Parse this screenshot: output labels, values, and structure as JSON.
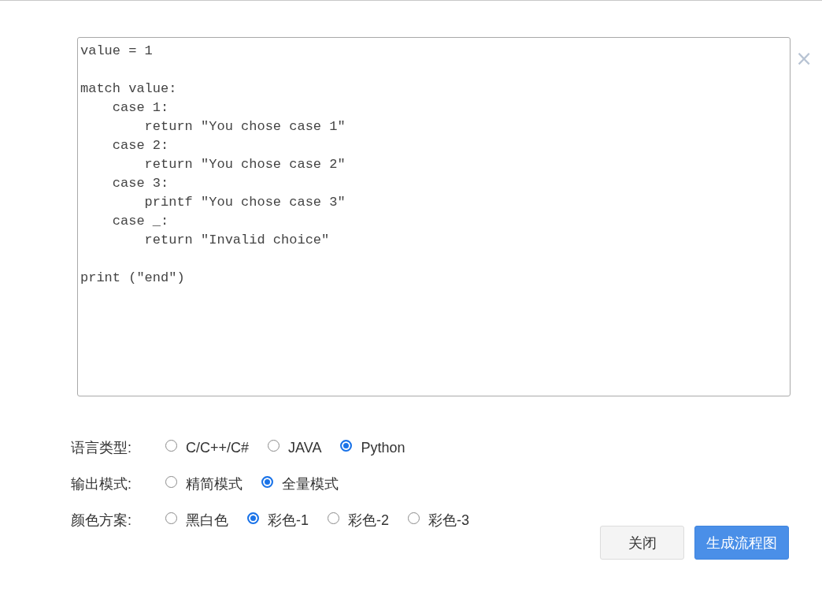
{
  "dialog": {
    "close": "×",
    "code": "value = 1\n\nmatch value:\n    case 1:\n        return ″You chose case 1″\n    case 2:\n        return ″You chose case 2″\n    case 3:\n        printf ″You chose case 3″\n    case _:\n        return ″Invalid choice″\n\nprint (″end″)",
    "options": [
      {
        "label": "语言类型:",
        "choices": [
          {
            "label": "C/C++/C#",
            "selected": false
          },
          {
            "label": "JAVA",
            "selected": false
          },
          {
            "label": "Python",
            "selected": true
          }
        ]
      },
      {
        "label": "输出模式:",
        "choices": [
          {
            "label": "精简模式",
            "selected": false
          },
          {
            "label": "全量模式",
            "selected": true
          }
        ]
      },
      {
        "label": "颜色方案:",
        "choices": [
          {
            "label": "黑白色",
            "selected": false
          },
          {
            "label": "彩色-1",
            "selected": true
          },
          {
            "label": "彩色-2",
            "selected": false
          },
          {
            "label": "彩色-3",
            "selected": false
          }
        ]
      }
    ],
    "buttons": [
      {
        "label": "关闭",
        "kind": "secondary"
      },
      {
        "label": "生成流程图",
        "kind": "primary"
      }
    ]
  }
}
